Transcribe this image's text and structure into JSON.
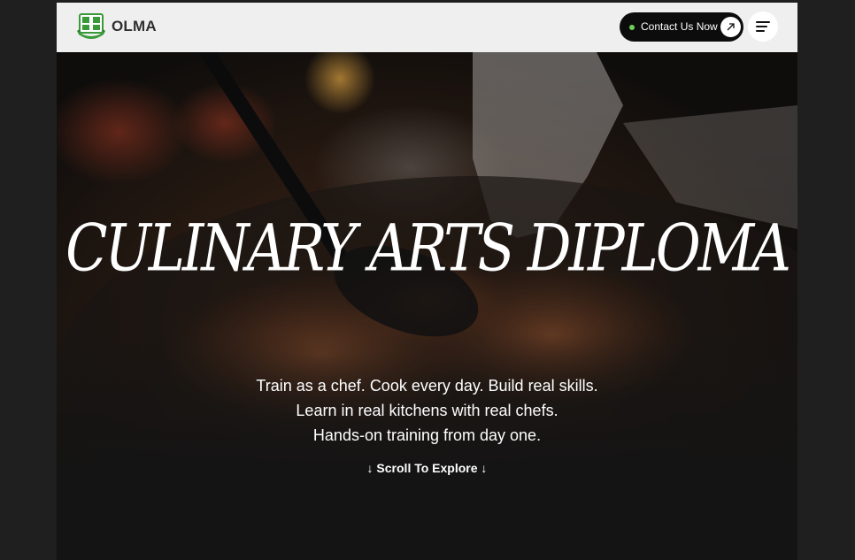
{
  "header": {
    "brand_name": "OLMA",
    "logo_icon": "school-crest-logo",
    "contact_label": "Contact Us Now",
    "contact_icon": "arrow-up-right-icon",
    "menu_icon": "hamburger-menu-icon",
    "colors": {
      "bar_background": "#efefef",
      "button_background": "#0c0c0c",
      "status_dot": "#6fcf5a",
      "logo_green": "#3a9a3a"
    }
  },
  "hero": {
    "title": "CULINARY ARTS DIPLOMA",
    "lines": [
      "Train as a chef. Cook every day. Build real skills.",
      "Learn in real kitchens with real chefs.",
      "Hands-on training from day one."
    ],
    "scroll_label": "↓ Scroll To Explore ↓"
  }
}
